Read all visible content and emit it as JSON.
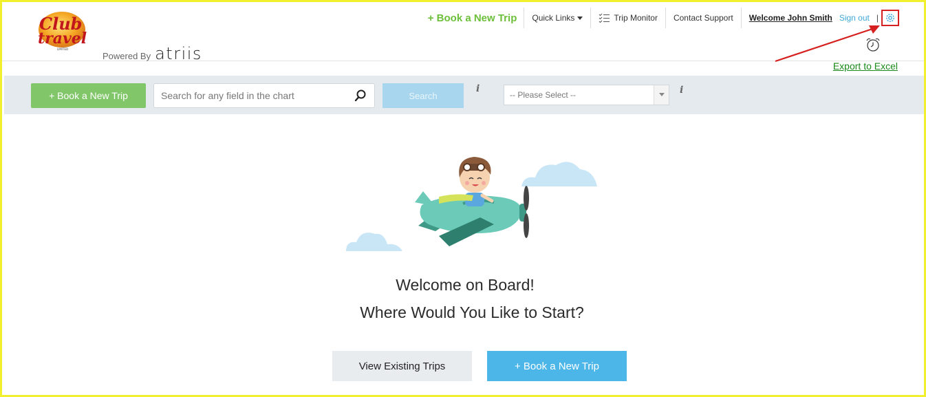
{
  "header": {
    "logo_alt": "Club Travel",
    "powered_label": "Powered By",
    "brand_name": "atriis",
    "nav": {
      "book_new_trip": "+ Book a New Trip",
      "quick_links": "Quick Links",
      "trip_monitor": "Trip Monitor",
      "contact_support": "Contact Support",
      "welcome_user": "Welcome John Smith",
      "sign_out": "Sign out",
      "separator": "|"
    },
    "export_to_excel": "Export to Excel"
  },
  "toolbar": {
    "book_button": "+ Book a New Trip",
    "search_placeholder": "Search for any field in the chart",
    "search_button": "Search",
    "info_glyph": "i",
    "select_value": "-- Please Select --"
  },
  "main": {
    "title": "Welcome on Board!",
    "subtitle": "Where Would You Like to Start?",
    "view_trips_button": "View Existing Trips",
    "book_trip_button": "+ Book a New Trip"
  },
  "colors": {
    "frame_border": "#f2ef2e",
    "nav_green": "#6cbf3a",
    "toolbar_bg": "#e5eaee",
    "green_button": "#82c66a",
    "search_button": "#a8d6ee",
    "blue_button": "#4db6e8",
    "annotation_red": "#d62020",
    "link_blue": "#3fa8d8",
    "export_green": "#1a8a1a"
  },
  "icons": [
    "club-travel-logo",
    "caret-down-icon",
    "checklist-icon",
    "gear-icon",
    "alarm-clock-icon",
    "search-icon",
    "info-icon",
    "chevron-down-icon",
    "pilot-airplane-illustration",
    "cloud-icon"
  ]
}
